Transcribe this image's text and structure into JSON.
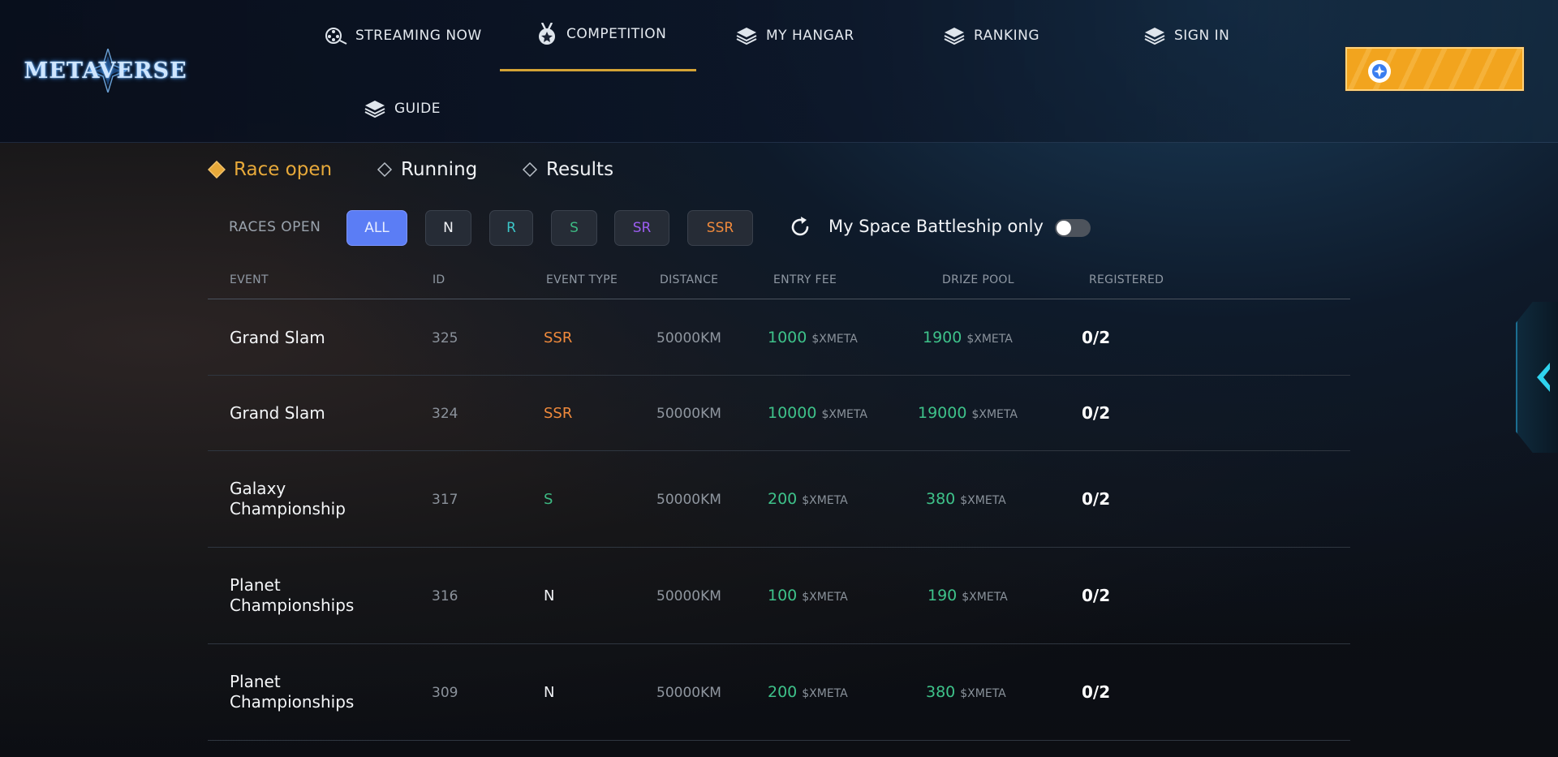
{
  "header": {
    "logo_text": "METAVERSE",
    "nav": [
      {
        "label": "STREAMING NOW",
        "icon": "film-reel-icon"
      },
      {
        "label": "COMPETITION",
        "icon": "medal-icon",
        "active": true
      },
      {
        "label": "MY HANGAR",
        "icon": "layers-icon"
      },
      {
        "label": "RANKING",
        "icon": "layers-icon"
      },
      {
        "label": "SIGN IN",
        "icon": "layers-icon"
      },
      {
        "label": "GUIDE",
        "icon": "layers-icon"
      }
    ],
    "wallet_icon": "compass-star-icon"
  },
  "status_tabs": [
    {
      "label": "Race open",
      "active": true
    },
    {
      "label": "Running"
    },
    {
      "label": "Results"
    }
  ],
  "filters": {
    "label": "RACES OPEN",
    "chips": [
      "ALL",
      "N",
      "R",
      "S",
      "SR",
      "SSR"
    ],
    "active": "ALL",
    "toggle_label": "My Space Battleship only",
    "toggle_on": false
  },
  "table": {
    "headers": [
      "EVENT",
      "ID",
      "EVENT TYPE",
      "DISTANCE",
      "ENTRY FEE",
      "DRIZE POOL",
      "REGISTERED"
    ],
    "rows": [
      {
        "event": "Grand Slam",
        "id": "325",
        "type": "SSR",
        "distance": "50000KM",
        "entry_fee": "1000",
        "entry_unit": "$XMETA",
        "pool": "1900",
        "pool_unit": "$XMETA",
        "registered": "0/2"
      },
      {
        "event": "Grand Slam",
        "id": "324",
        "type": "SSR",
        "distance": "50000KM",
        "entry_fee": "10000",
        "entry_unit": "$XMETA",
        "pool": "19000",
        "pool_unit": "$XMETA",
        "registered": "0/2"
      },
      {
        "event": "Galaxy Championship",
        "event_lines": [
          "Galaxy",
          "Championship"
        ],
        "id": "317",
        "type": "S",
        "distance": "50000KM",
        "entry_fee": "200",
        "entry_unit": "$XMETA",
        "pool": "380",
        "pool_unit": "$XMETA",
        "registered": "0/2"
      },
      {
        "event": "Planet Championships",
        "event_lines": [
          "Planet",
          "Championships"
        ],
        "id": "316",
        "type": "N",
        "distance": "50000KM",
        "entry_fee": "100",
        "entry_unit": "$XMETA",
        "pool": "190",
        "pool_unit": "$XMETA",
        "registered": "0/2"
      },
      {
        "event": "Planet Championships",
        "event_lines": [
          "Planet",
          "Championships"
        ],
        "id": "309",
        "type": "N",
        "distance": "50000KM",
        "entry_fee": "200",
        "entry_unit": "$XMETA",
        "pool": "380",
        "pool_unit": "$XMETA",
        "registered": "0/2"
      }
    ]
  },
  "colors": {
    "accent_gold": "#d4a335",
    "active_chip": "#5b7df5",
    "green_value": "#3ec28a",
    "ssr": "#f08a3c",
    "sr": "#9b5df0",
    "r": "#3cc6c8",
    "s": "#3dba83",
    "wallet_orange": "#f2a41e"
  },
  "side_panel_icon": "chevron-left-icon"
}
